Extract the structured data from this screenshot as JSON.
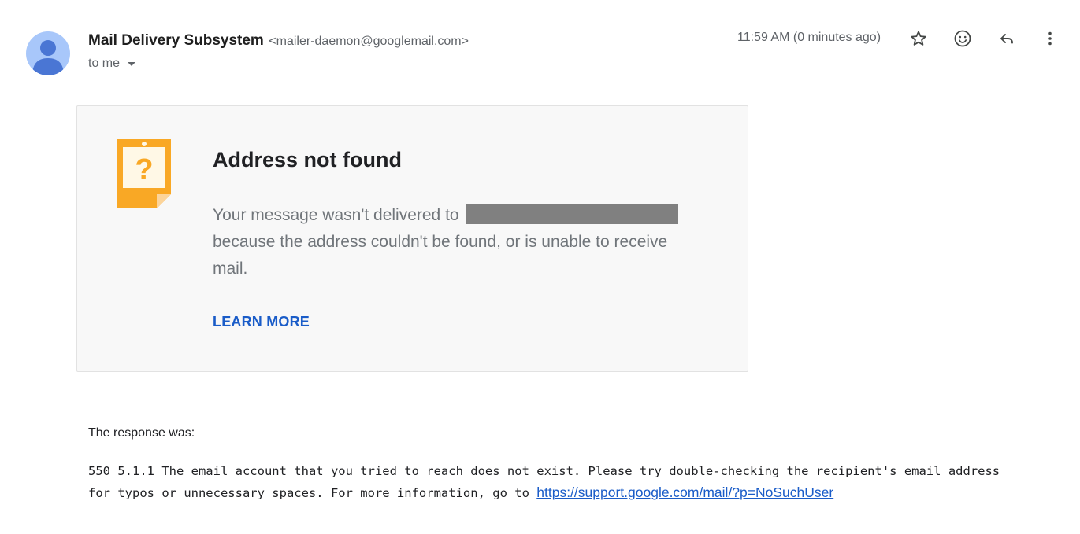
{
  "header": {
    "sender_name": "Mail Delivery Subsystem",
    "sender_email": "<mailer-daemon@googlemail.com>",
    "recipient": "to me",
    "timestamp": "11:59 AM (0 minutes ago)"
  },
  "icons": {
    "avatar": "person-icon",
    "star": "star-icon",
    "emoji": "emoji-icon",
    "reply": "reply-icon",
    "more": "more-vert-icon",
    "card": "question-note-icon"
  },
  "card": {
    "title": "Address not found",
    "message_prefix": "Your message wasn't delivered to",
    "message_suffix": "because the address couldn't be found, or is unable to receive mail.",
    "learn_more": "LEARN MORE"
  },
  "response": {
    "label": "The response was:",
    "line1": "550 5.1.1 The email account that you tried to reach does not exist. Please try double-checking the recipient's email address",
    "line2": "for typos or unnecessary spaces. For more information, go to",
    "link": "https://support.google.com/mail/?p=NoSuchUser"
  },
  "colors": {
    "link": "#1a5cc8",
    "avatar_bg": "#a8c7fa",
    "avatar_fg": "#4f7ed8",
    "card_bg": "#f8f8f8",
    "icon_orange": "#f9a825",
    "redaction": "#808080"
  }
}
